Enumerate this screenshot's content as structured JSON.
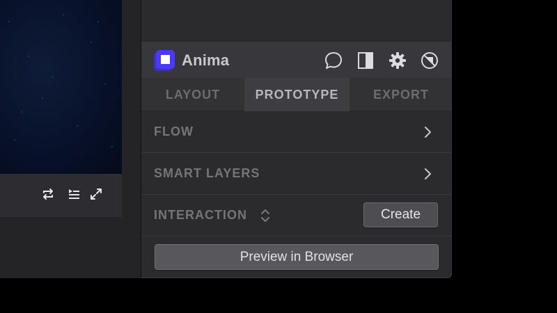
{
  "plugin": {
    "name": "Anima",
    "brand_color": "#4a3bf0",
    "header_icons": [
      "comment-icon",
      "panel-toggle-icon",
      "gear-icon",
      "no-preview-icon"
    ]
  },
  "tabs": [
    {
      "label": "LAYOUT",
      "active": false
    },
    {
      "label": "PROTOTYPE",
      "active": true
    },
    {
      "label": "EXPORT",
      "active": false
    }
  ],
  "sections": {
    "flow": {
      "label": "FLOW"
    },
    "smart_layers": {
      "label": "SMART LAYERS"
    },
    "interaction": {
      "label": "INTERACTION",
      "button_label": "Create"
    }
  },
  "actions": {
    "preview_label": "Preview in Browser"
  },
  "video_controls": [
    "loop-icon",
    "playlist-icon",
    "fullscreen-icon"
  ]
}
